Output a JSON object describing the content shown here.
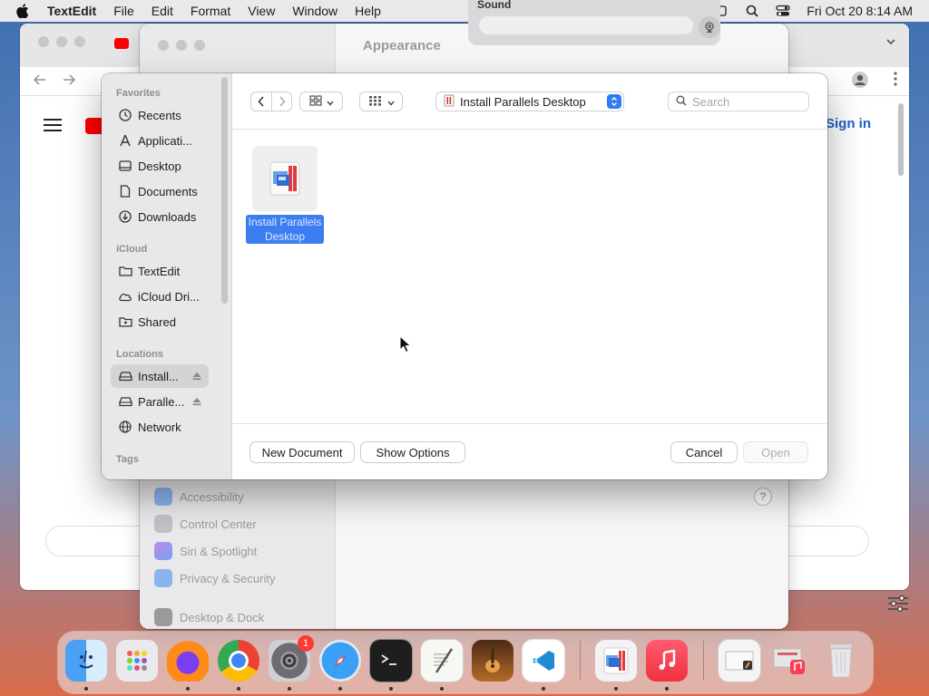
{
  "menubar": {
    "app_name": "TextEdit",
    "items": [
      "File",
      "Edit",
      "Format",
      "View",
      "Window",
      "Help"
    ],
    "datetime": "Fri Oct 20  8:14 AM"
  },
  "sound_popover": {
    "title": "Sound"
  },
  "browser": {
    "sign_in": "Sign in"
  },
  "settings": {
    "heading": "Appearance",
    "sidebar": [
      "Accessibility",
      "Control Center",
      "Siri & Spotlight",
      "Privacy & Security",
      "Desktop & Dock"
    ],
    "help": "?"
  },
  "dialog": {
    "sections": {
      "favorites": "Favorites",
      "icloud": "iCloud",
      "locations": "Locations",
      "tags": "Tags"
    },
    "favorites": [
      "Recents",
      "Applicati...",
      "Desktop",
      "Documents",
      "Downloads"
    ],
    "icloud": [
      "TextEdit",
      "iCloud Dri...",
      "Shared"
    ],
    "locations": [
      "Install...",
      "Paralle...",
      "Network"
    ],
    "location_popup": "Install Parallels Desktop",
    "search_placeholder": "Search",
    "file": {
      "line1": "Install Parallels",
      "line2": "Desktop"
    },
    "buttons": {
      "new_document": "New Document",
      "show_options": "Show Options",
      "cancel": "Cancel",
      "open": "Open"
    }
  },
  "dock": {
    "settings_badge": "1"
  },
  "colors": {
    "accent": "#2f7cf6",
    "selection": "#3d7df2"
  }
}
